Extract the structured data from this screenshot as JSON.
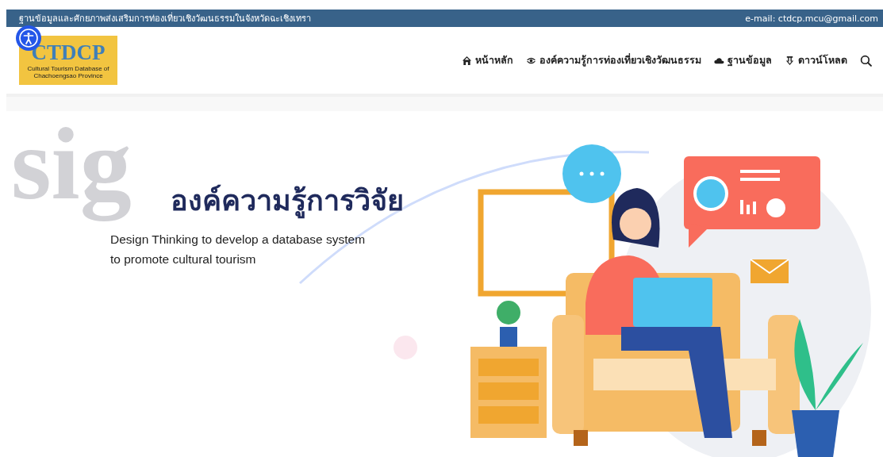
{
  "top_bar": {
    "site_title": "ฐานข้อมูลและศักยภาพส่งเสริมการท่องเที่ยวเชิงวัฒนธรรมในจังหวัดฉะเชิงเทรา",
    "email": "e-mail: ctdcp.mcu@gmail.com"
  },
  "logo": {
    "name": "CTDCP",
    "subtitle": "Cultural Tourism Database of Chachoengsao Province"
  },
  "nav": [
    {
      "kind": "home",
      "label": "หน้าหลัก"
    },
    {
      "kind": "eye",
      "label": "องค์ความรู้การท่องเที่ยวเชิงวัฒนธรรม"
    },
    {
      "kind": "cloud",
      "label": "ฐานข้อมูล"
    },
    {
      "kind": "download",
      "label": "ดาวน์โหลด"
    },
    {
      "kind": "search"
    }
  ],
  "hero": {
    "background_word": "sig",
    "title": "องค์ความรู้การวิจัย",
    "subtitle": "Design Thinking to develop a database system to promote cultural tourism"
  }
}
